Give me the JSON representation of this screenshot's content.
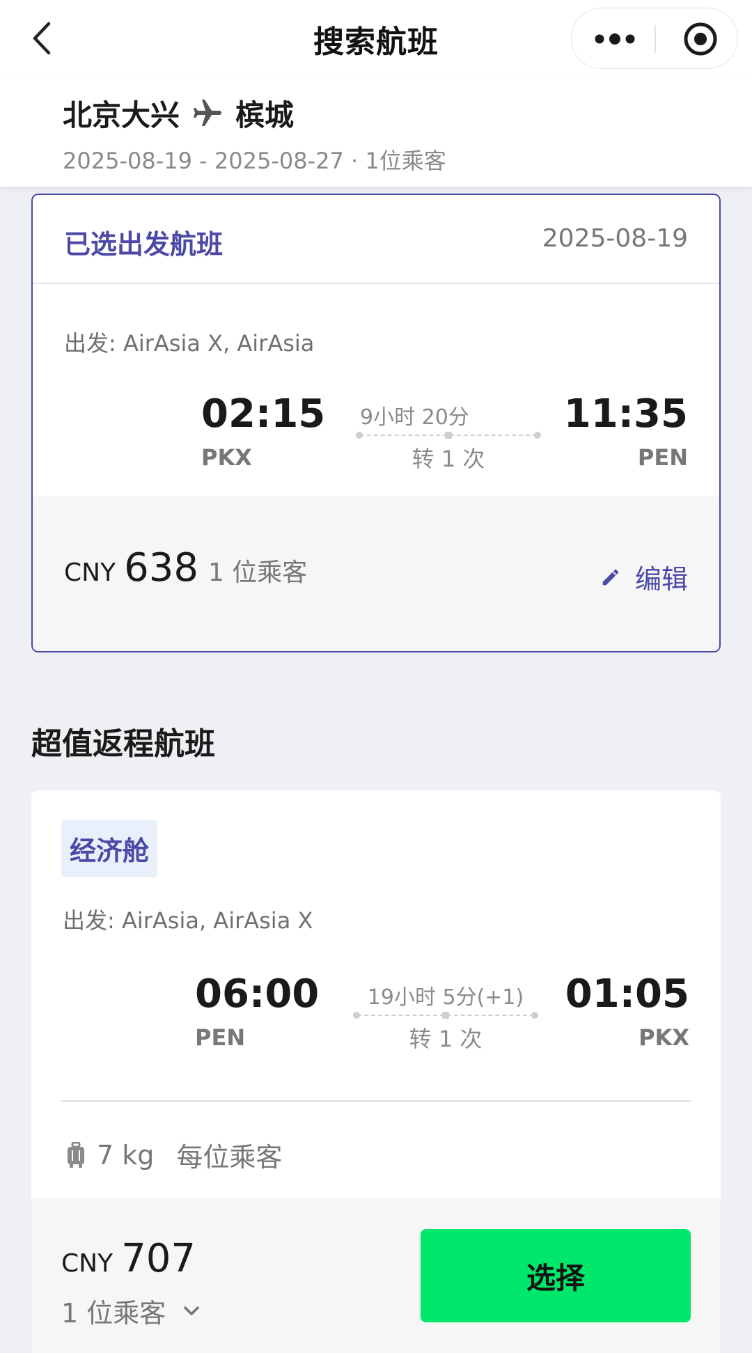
{
  "nav": {
    "title": "搜索航班",
    "back_icon": "chevron-left-icon",
    "more_icon": "more-dots-icon",
    "close_icon": "target-close-icon"
  },
  "route": {
    "from": "北京大兴",
    "to": "槟城",
    "plane_icon": "airplane-icon",
    "subline": "2025-08-19 - 2025-08-27 · 1位乘客"
  },
  "selected": {
    "label": "已选出发航班",
    "date": "2025-08-19",
    "carrier": "出发: AirAsia X, AirAsia",
    "dep_time": "02:15",
    "dep_code": "PKX",
    "duration": "9小时 20分",
    "stops": "转 1 次",
    "arr_time": "11:35",
    "arr_code": "PEN",
    "currency": "CNY",
    "price": "638",
    "pax": "1 位乘客",
    "edit_label": "编辑"
  },
  "return_section": {
    "title": "超值返程航班"
  },
  "return_flight": {
    "cabin": "经济舱",
    "carrier": "出发: AirAsia, AirAsia X",
    "dep_time": "06:00",
    "dep_code": "PEN",
    "duration": "19小时 5分(+1)",
    "stops": "转 1 次",
    "arr_time": "01:05",
    "arr_code": "PKX",
    "baggage_weight": "7 kg",
    "baggage_note": "每位乘客",
    "currency": "CNY",
    "price": "707",
    "pax_select": "1 位乘客",
    "select_label": "选择"
  },
  "colors": {
    "accent": "#4a4aa6",
    "select_button": "#00e76b",
    "background": "#eef0f4"
  }
}
